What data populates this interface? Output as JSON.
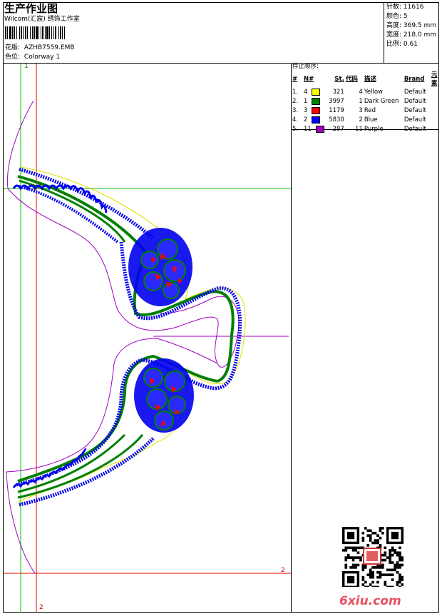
{
  "header": {
    "title": "生产作业图",
    "studio": "Wilcom(汇宸) 绣饰工作室",
    "pattern_label": "花版:",
    "pattern_value": "AZHB7559.EMB",
    "colorway_label": "色位:",
    "colorway_value": "Colorway 1"
  },
  "stats": {
    "stitches": "针数: 11616",
    "colors": "颜色: 5",
    "height": "高度: 369.5 mm",
    "width": "宽度: 218.0 mm",
    "scale": "比例: 0.61"
  },
  "stop_sequence": {
    "caption": "停止顺序:",
    "columns": [
      "#",
      "N#",
      "St.",
      "代码",
      "描述",
      "Brand",
      "元素"
    ],
    "rows": [
      {
        "idx": "1.",
        "n": "4",
        "st": "321",
        "code": "4",
        "desc": "Yellow",
        "brand": "Default",
        "color": "#ffff00"
      },
      {
        "idx": "2.",
        "n": "1",
        "st": "3997",
        "code": "1",
        "desc": "Dark Green",
        "brand": "Default",
        "color": "#008000"
      },
      {
        "idx": "3.",
        "n": "3",
        "st": "1179",
        "code": "3",
        "desc": "Red",
        "brand": "Default",
        "color": "#ff0000"
      },
      {
        "idx": "4.",
        "n": "2",
        "st": "5830",
        "code": "2",
        "desc": "Blue",
        "brand": "Default",
        "color": "#0000ff"
      },
      {
        "idx": "5.",
        "n": "11",
        "st": "287",
        "code": "11",
        "desc": "Purple",
        "brand": "Default",
        "color": "#a000c0"
      }
    ]
  },
  "markers": {
    "m1": "1",
    "m2a": "2",
    "m2b": "2"
  },
  "watermark": {
    "site": "6xiu.com"
  }
}
